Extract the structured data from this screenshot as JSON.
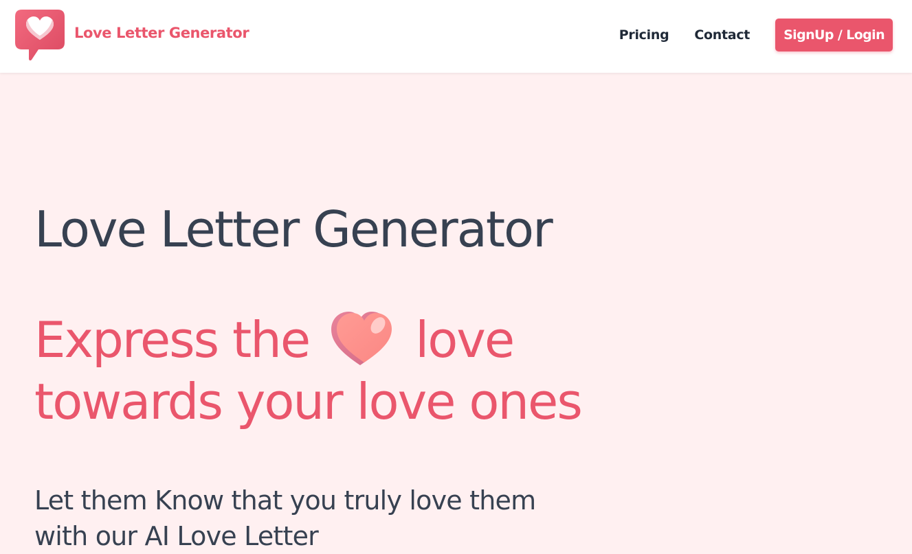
{
  "header": {
    "brand_name": "Love Letter Generator",
    "logo_icon": "heart-speech-bubble-icon",
    "nav": {
      "pricing": "Pricing",
      "contact": "Contact",
      "signup_login": "SignUp / Login"
    }
  },
  "hero": {
    "title": "Love Letter Generator",
    "tagline_before": "Express the",
    "tagline_emoji": "heart-emoji",
    "tagline_after": "love",
    "tagline_line2": "towards your love ones",
    "description": "Let them Know that you truly love them with our AI Love Letter"
  },
  "colors": {
    "accent": "#ea566c",
    "text_dark": "#374151",
    "hero_background": "#fff0f1",
    "header_background": "#ffffff"
  }
}
